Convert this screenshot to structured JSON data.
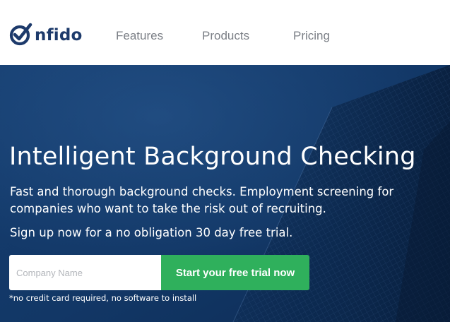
{
  "header": {
    "logo": {
      "icon": "checkmark-o-icon",
      "text": "nfido",
      "brand_color": "#1d3a6b"
    },
    "nav": [
      {
        "label": "Features"
      },
      {
        "label": "Products"
      },
      {
        "label": "Pricing"
      }
    ]
  },
  "hero": {
    "title": "Intelligent Background Checking",
    "description": "Fast and thorough background checks. Employment screening for companies who want to take the risk out of recruiting.",
    "offer": "Sign up now for a no obligation 30 day free trial.",
    "form": {
      "company_placeholder": "Company Name",
      "company_value": "",
      "submit_label": "Start your free trial now"
    },
    "fine_print": "*no credit card required, no software to install",
    "background_color": "#123a6a",
    "cta_color": "#2fb05c"
  }
}
